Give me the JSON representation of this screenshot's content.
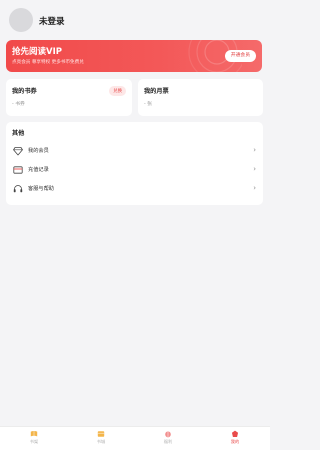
{
  "header": {
    "username": "未登录"
  },
  "vip": {
    "title": "抢先阅读VIP",
    "subtitle": "点亮会员 尊享特权 更多书币免费兑",
    "button_label": "开通会员"
  },
  "cards": {
    "coupons": {
      "title": "我的书券",
      "value": "- 书券",
      "badge": "兑换"
    },
    "monthly": {
      "title": "我的月票",
      "value": "- 张"
    }
  },
  "other": {
    "title": "其他",
    "items": [
      {
        "label": "我的会员",
        "icon": "diamond-icon"
      },
      {
        "label": "充值记录",
        "icon": "card-icon"
      },
      {
        "label": "客服与帮助",
        "icon": "headset-icon"
      }
    ]
  },
  "nav": {
    "items": [
      {
        "label": "书架",
        "icon": "bookshelf-icon"
      },
      {
        "label": "书城",
        "icon": "bookstore-icon"
      },
      {
        "label": "福利",
        "icon": "gift-icon"
      },
      {
        "label": "我的",
        "icon": "profile-icon"
      }
    ],
    "active_index": 3
  },
  "colors": {
    "accent": "#f14a4a",
    "background": "#f4f4f6",
    "card": "#ffffff"
  }
}
